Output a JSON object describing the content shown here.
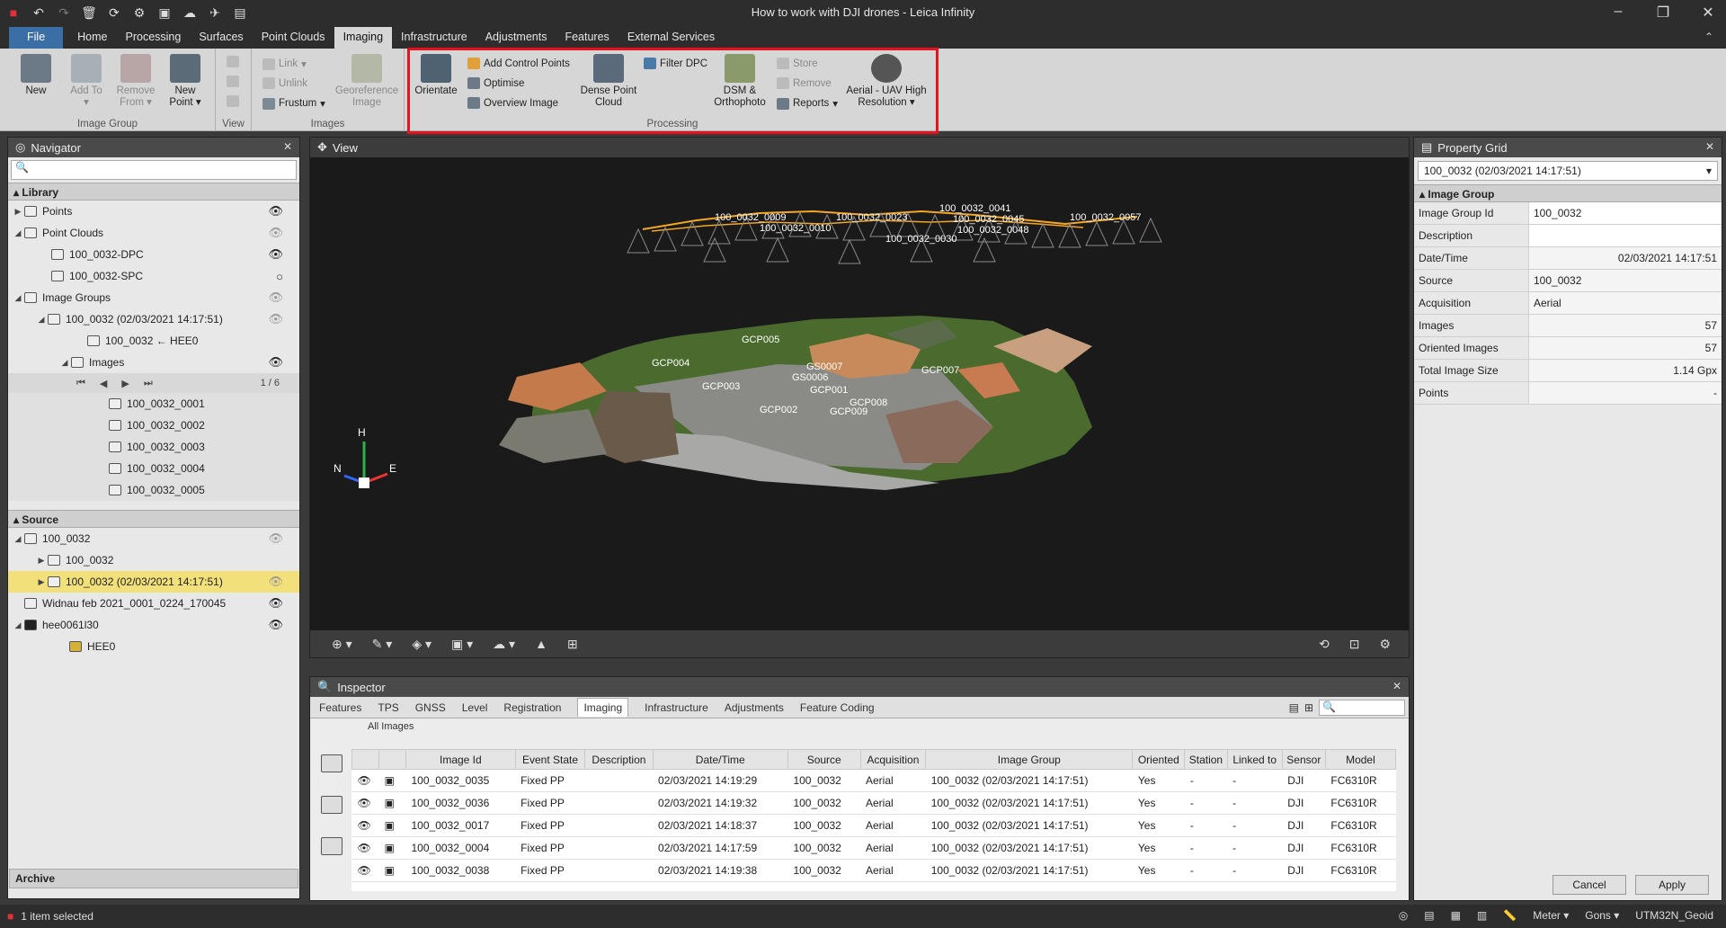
{
  "window": {
    "title": "How to work with DJI drones - Leica Infinity"
  },
  "tabs": [
    "File",
    "Home",
    "Processing",
    "Surfaces",
    "Point Clouds",
    "Imaging",
    "Infrastructure",
    "Adjustments",
    "Features",
    "External Services"
  ],
  "ribbon": {
    "image_group": {
      "label": "Image Group",
      "new": "New",
      "add_to": "Add To",
      "remove_from": "Remove From",
      "new_point": "New Point"
    },
    "view": {
      "label": "View"
    },
    "images": {
      "label": "Images",
      "link": "Link",
      "unlink": "Unlink",
      "frustum": "Frustum",
      "georeference": "Georeference Image"
    },
    "processing": {
      "label": "Processing",
      "orientate": "Orientate",
      "add_control_points": "Add Control Points",
      "optimise": "Optimise",
      "overview_image": "Overview Image",
      "dense_point_cloud": "Dense Point Cloud",
      "filter_dpc": "Filter DPC",
      "dsm_orthophoto": "DSM & Orthophoto",
      "store": "Store",
      "remove": "Remove",
      "reports": "Reports",
      "aerial_uav": "Aerial - UAV High Resolution"
    }
  },
  "navigator": {
    "title": "Navigator",
    "library_label": "Library",
    "library": [
      {
        "label": "Points"
      },
      {
        "label": "Point Clouds"
      },
      {
        "label": "100_0032-DPC"
      },
      {
        "label": "100_0032-SPC"
      },
      {
        "label": "Image Groups"
      },
      {
        "label": "100_0032 (02/03/2021 14:17:51)"
      },
      {
        "label": "100_0032 ← HEE0"
      },
      {
        "label": "Images"
      },
      {
        "label": "100_0032_0001"
      },
      {
        "label": "100_0032_0002"
      },
      {
        "label": "100_0032_0003"
      },
      {
        "label": "100_0032_0004"
      },
      {
        "label": "100_0032_0005"
      }
    ],
    "pager": "1 / 6",
    "source_label": "Source",
    "source": [
      {
        "label": "100_0032"
      },
      {
        "label": "100_0032"
      },
      {
        "label": "100_0032 (02/03/2021 14:17:51)"
      },
      {
        "label": "Widnau feb 2021_0001_0224_170045"
      },
      {
        "label": "hee0061l30"
      },
      {
        "label": "HEE0"
      }
    ],
    "archive_label": "Archive"
  },
  "view": {
    "title": "View",
    "camera_labels": [
      "100_0032_0057",
      "100_0032_0041",
      "100_0032_0045",
      "100_0032_0048",
      "100_0032_0023",
      "100_0032_0010",
      "100_0032_0030",
      "100_0032_0009"
    ],
    "gcp_labels": [
      "GCP005",
      "GCP004",
      "GCP003",
      "GCP002",
      "GCP001",
      "GCP008",
      "GCP009",
      "GCP007",
      "GS0006",
      "GS0007"
    ],
    "axis": {
      "h": "H",
      "n": "N",
      "e": "E"
    }
  },
  "inspector": {
    "title": "Inspector",
    "tabs": [
      "Features",
      "TPS",
      "GNSS",
      "Level",
      "Registration",
      "Imaging",
      "Infrastructure",
      "Adjustments",
      "Feature Coding"
    ],
    "breadcrumb": "All Images",
    "columns": [
      "Image Id",
      "Event State",
      "Description",
      "Date/Time",
      "Source",
      "Acquisition",
      "Image Group",
      "Oriented",
      "Station",
      "Linked to",
      "Sensor",
      "Model"
    ],
    "rows": [
      [
        "100_0032_0035",
        "Fixed PP",
        "",
        "02/03/2021 14:19:29",
        "100_0032",
        "Aerial",
        "100_0032 (02/03/2021 14:17:51)",
        "Yes",
        "-",
        "-",
        "DJI",
        "FC6310R"
      ],
      [
        "100_0032_0036",
        "Fixed PP",
        "",
        "02/03/2021 14:19:32",
        "100_0032",
        "Aerial",
        "100_0032 (02/03/2021 14:17:51)",
        "Yes",
        "-",
        "-",
        "DJI",
        "FC6310R"
      ],
      [
        "100_0032_0017",
        "Fixed PP",
        "",
        "02/03/2021 14:18:37",
        "100_0032",
        "Aerial",
        "100_0032 (02/03/2021 14:17:51)",
        "Yes",
        "-",
        "-",
        "DJI",
        "FC6310R"
      ],
      [
        "100_0032_0004",
        "Fixed PP",
        "",
        "02/03/2021 14:17:59",
        "100_0032",
        "Aerial",
        "100_0032 (02/03/2021 14:17:51)",
        "Yes",
        "-",
        "-",
        "DJI",
        "FC6310R"
      ],
      [
        "100_0032_0038",
        "Fixed PP",
        "",
        "02/03/2021 14:19:38",
        "100_0032",
        "Aerial",
        "100_0032 (02/03/2021 14:17:51)",
        "Yes",
        "-",
        "-",
        "DJI",
        "FC6310R"
      ]
    ]
  },
  "property_grid": {
    "title": "Property Grid",
    "selected": "100_0032 (02/03/2021 14:17:51)",
    "section": "Image Group",
    "rows": [
      {
        "k": "Image Group Id",
        "v": "100_0032"
      },
      {
        "k": "Description",
        "v": ""
      },
      {
        "k": "Date/Time",
        "v": "02/03/2021 14:17:51"
      },
      {
        "k": "Source",
        "v": "100_0032"
      },
      {
        "k": "Acquisition",
        "v": "Aerial"
      },
      {
        "k": "Images",
        "v": "57"
      },
      {
        "k": "Oriented Images",
        "v": "57"
      },
      {
        "k": "Total Image Size",
        "v": "1.14 Gpx"
      },
      {
        "k": "Points",
        "v": "-"
      }
    ],
    "cancel": "Cancel",
    "apply": "Apply"
  },
  "status": {
    "selection": "1 item selected",
    "units": "Meter",
    "angle": "Gons",
    "crs": "UTM32N_Geoid"
  },
  "colors": {
    "accent": "#3a6ea5",
    "highlight_box": "#e8121e",
    "selected_row": "#f2e07a",
    "camera_track": "#f5a623"
  }
}
